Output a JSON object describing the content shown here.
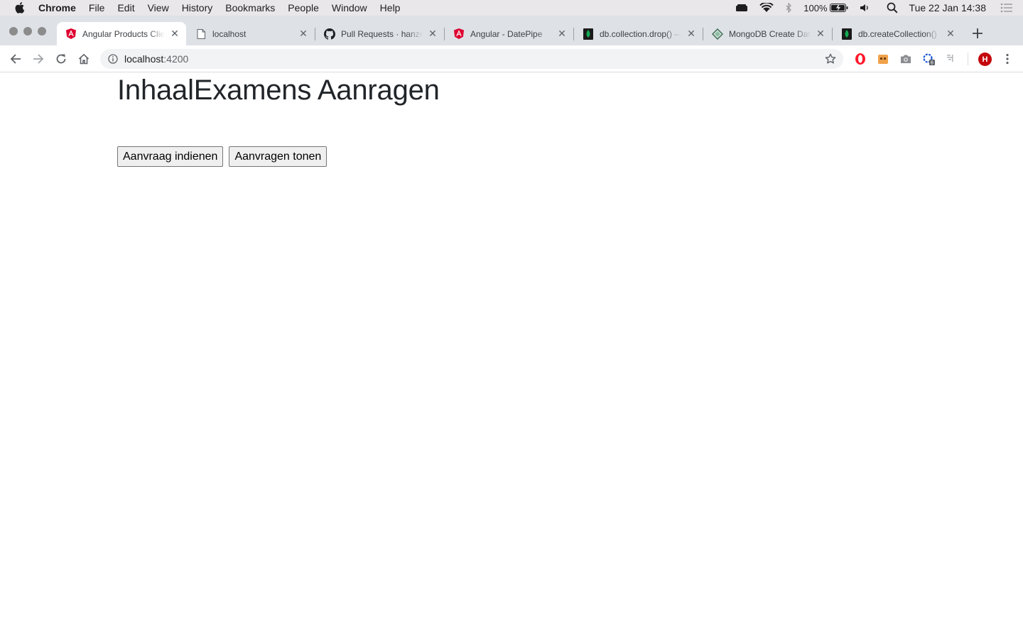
{
  "menubar": {
    "app_name": "Chrome",
    "items": [
      "File",
      "Edit",
      "View",
      "History",
      "Bookmarks",
      "People",
      "Window",
      "Help"
    ],
    "battery": "100%",
    "clock": "Tue 22 Jan  14:38"
  },
  "tabs": [
    {
      "title": "Angular Products Client",
      "icon": "angular-icon",
      "active": true
    },
    {
      "title": "localhost",
      "icon": "page-icon",
      "active": false
    },
    {
      "title": "Pull Requests · hanze",
      "icon": "github-icon",
      "active": false
    },
    {
      "title": "Angular - DatePipe",
      "icon": "angular-icon",
      "active": false
    },
    {
      "title": "db.collection.drop() — MongoDB",
      "icon": "mongodb-leaf-icon",
      "active": false
    },
    {
      "title": "MongoDB Create Database",
      "icon": "mongodb-diamond-icon",
      "active": false
    },
    {
      "title": "db.createCollection()",
      "icon": "mongodb-leaf-icon",
      "active": false
    }
  ],
  "address_bar": {
    "host": "localhost",
    "port": ":4200"
  },
  "profile_initial": "H",
  "extension_badge": "6",
  "page": {
    "heading": "InhaalExamens Aanragen",
    "buttons": {
      "submit_label": "Aanvraag indienen",
      "show_label": "Aanvragen tonen"
    }
  },
  "colors": {
    "angular_red": "#dd0031",
    "mongodb_green": "#13aa52",
    "profile_red": "#c5080e",
    "opera_red": "#ff1b2d"
  }
}
